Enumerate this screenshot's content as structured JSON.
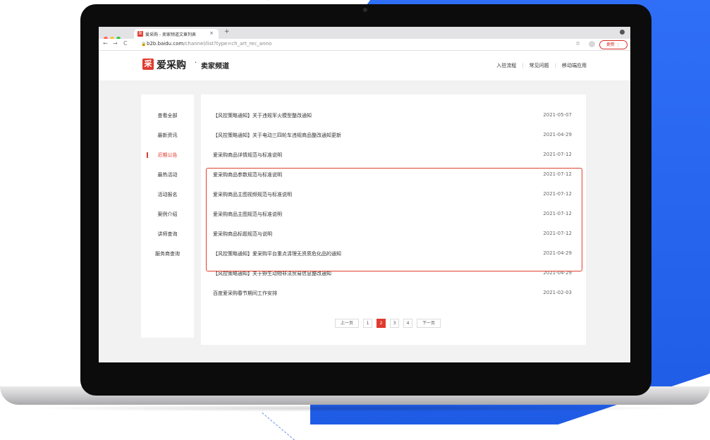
{
  "browser": {
    "tab_title": "爱采购 - 卖家频道文章列表",
    "tab_favicon": "采",
    "tab_close": "×",
    "new_tab": "+",
    "url_host": "b2b.baidu.com",
    "url_path": "/channel/list?type=ch_art_rec_anno",
    "update_label": "更新 ⋮",
    "back_icon": "←",
    "forward_icon": "→",
    "reload_icon": "C",
    "star_icon": "☆"
  },
  "site": {
    "logo_mark": "采",
    "logo_text": "爱采购",
    "logo_sep": "·",
    "logo_sub": "卖家频道",
    "nav": [
      "入驻流程",
      "常见问题",
      "移动端应用"
    ]
  },
  "sidebar": {
    "items": [
      {
        "label": "查看全部",
        "active": false
      },
      {
        "label": "最新资讯",
        "active": false
      },
      {
        "label": "近期公告",
        "active": true
      },
      {
        "label": "最热活动",
        "active": false
      },
      {
        "label": "活动报名",
        "active": false
      },
      {
        "label": "案例介绍",
        "active": false
      },
      {
        "label": "讲师查询",
        "active": false
      },
      {
        "label": "服务商查询",
        "active": false
      }
    ]
  },
  "articles": [
    {
      "title": "【风控策略通知】关于违规军火模型整改通知",
      "date": "2021-05-07"
    },
    {
      "title": "【风控策略通知】关于电动三四轮车违规商品整改通知更新",
      "date": "2021-04-29"
    },
    {
      "title": "爱采购商品详情规范与标准说明",
      "date": "2021-07-12"
    },
    {
      "title": "爱采购商品参数规范与标准说明",
      "date": "2021-07-12"
    },
    {
      "title": "爱采购商品主图视频规范与标准说明",
      "date": "2021-07-12"
    },
    {
      "title": "爱采购商品主图规范与标准说明",
      "date": "2021-07-12"
    },
    {
      "title": "爱采购商品标题规范与说明",
      "date": "2021-07-12"
    },
    {
      "title": "【风控策略通知】爱采购平台重点清理无资质危化品的通知",
      "date": "2021-04-29"
    },
    {
      "title": "【风控策略通知】关于野生动物非法贸易信息整改通知",
      "date": "2021-04-29"
    },
    {
      "title": "百度爱采购春节期间工作安排",
      "date": "2021-02-03"
    }
  ],
  "pagination": {
    "prev": "上一页",
    "pages": [
      "1",
      "2",
      "3",
      "4"
    ],
    "current": "2",
    "next": "下一页"
  },
  "colors": {
    "brand_red": "#e03a2f",
    "background_blue": "#2f6ef7"
  }
}
